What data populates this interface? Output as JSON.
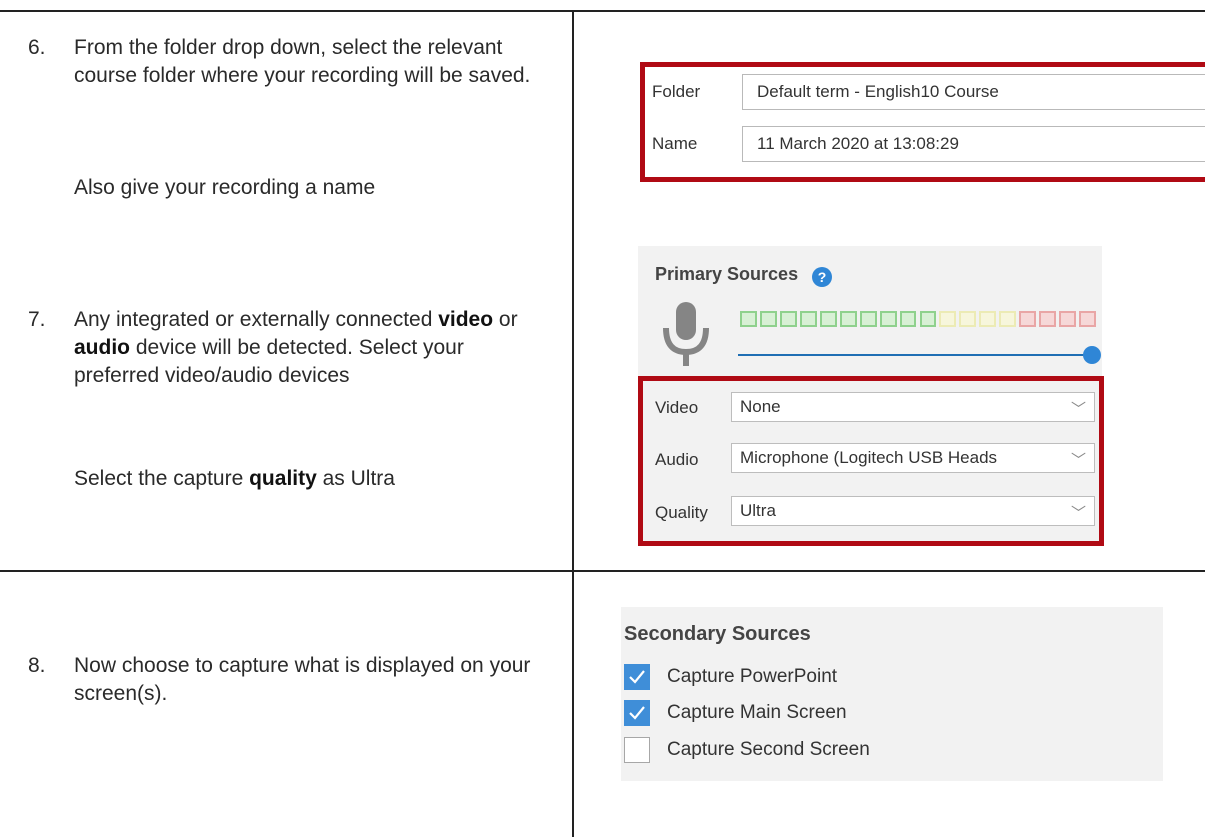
{
  "steps": {
    "s6": {
      "number": "6.",
      "text": "From the folder drop down, select the relevant course folder where your recording will be saved.",
      "sub": "Also give your recording a name"
    },
    "s7": {
      "number": "7.",
      "text_a": "Any integrated or externally connected ",
      "bold_video": "video",
      "text_b": " or ",
      "bold_audio": "audio",
      "text_c": " device will be detected. Select your preferred video/audio devices",
      "sub_a": "Select the capture ",
      "bold_quality": "quality",
      "sub_b": " as Ultra"
    },
    "s8": {
      "number": "8.",
      "text": "Now choose to capture what is displayed on your screen(s)."
    }
  },
  "folder_panel": {
    "folder_label": "Folder",
    "folder_value": "Default term - English10 Course",
    "name_label": "Name",
    "name_value": "11 March 2020 at 13:08:29"
  },
  "primary_sources": {
    "title": "Primary Sources",
    "help_icon": "?",
    "audio_level_meter": {
      "segments_green": 10,
      "segments_yellow": 4,
      "segments_red": 4
    },
    "volume_level": 1.0,
    "video_label": "Video",
    "video_value": "None",
    "audio_label": "Audio",
    "audio_value": "Microphone (Logitech USB Heads",
    "quality_label": "Quality",
    "quality_value": "Ultra"
  },
  "secondary_sources": {
    "title": "Secondary Sources",
    "items": [
      {
        "label": "Capture PowerPoint",
        "checked": true
      },
      {
        "label": "Capture Main Screen",
        "checked": true
      },
      {
        "label": "Capture Second Screen",
        "checked": false
      }
    ]
  },
  "colors": {
    "highlight_border": "#b00a14",
    "accent_blue": "#2f86d6",
    "meter_green": "#8fd18d",
    "meter_yellow": "#ecebb5",
    "meter_red": "#e9a6a6"
  }
}
